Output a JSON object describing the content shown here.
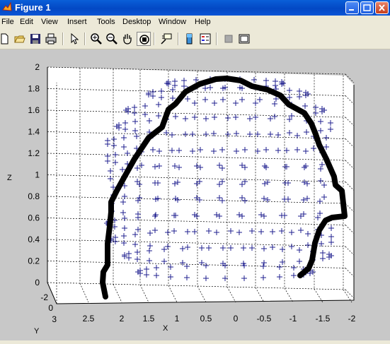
{
  "window": {
    "title": "Figure 1"
  },
  "menu": [
    "File",
    "Edit",
    "View",
    "Insert",
    "Tools",
    "Desktop",
    "Window",
    "Help"
  ],
  "toolbar_icons": [
    "new-file-icon",
    "open-file-icon",
    "save-icon",
    "print-icon",
    "edit-plot-arrow-icon",
    "zoom-in-icon",
    "zoom-out-icon",
    "pan-hand-icon",
    "rotate-3d-icon",
    "data-cursor-icon",
    "colorbar-icon",
    "legend-icon",
    "hide-plot-tools-icon",
    "show-plot-tools-icon"
  ],
  "axes": {
    "zlabel": "Z",
    "xlabel": "X",
    "ylabel": "Y",
    "z_ticks": [
      "2",
      "1.8",
      "1.6",
      "1.4",
      "1.2",
      "1",
      "0.8",
      "0.6",
      "0.4",
      "0.2",
      "0"
    ],
    "x_ticks": [
      "2.5",
      "2",
      "1.5",
      "1",
      "0.5",
      "0",
      "-0.5",
      "-1",
      "-1.5",
      "-2"
    ],
    "y_ticks": [
      "-2",
      "0",
      "3"
    ]
  },
  "chart_data": {
    "type": "scatter",
    "projection": "3d",
    "zlabel": "Z",
    "xlabel": "X",
    "ylabel": "Y",
    "xlim": [
      2.5,
      -2
    ],
    "zlim": [
      0,
      2
    ],
    "grid": true,
    "marker": "+",
    "marker_color": "#1f1f8f",
    "outline_color": "#000000",
    "ring_levels_z": [
      1.85,
      1.75,
      1.6,
      1.45,
      1.3,
      1.15,
      1.0,
      0.85,
      0.7,
      0.55,
      0.4,
      0.25,
      0.1
    ],
    "outline_note": "thick black contour tracing the head silhouette"
  }
}
